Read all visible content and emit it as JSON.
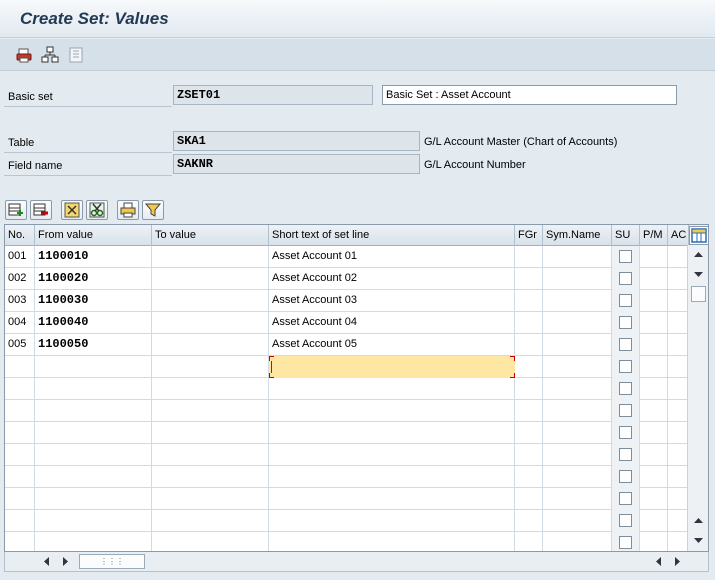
{
  "window": {
    "title": "Create Set: Values"
  },
  "app_toolbar": {
    "icons": [
      "print-icon",
      "hierarchy-icon",
      "document-icon"
    ]
  },
  "header": {
    "basic_set": {
      "label": "Basic set",
      "value": "ZSET01",
      "description": "Basic Set : Asset Account"
    },
    "table": {
      "label": "Table",
      "value": "SKA1",
      "description": "G/L Account Master (Chart of Accounts)"
    },
    "field_name": {
      "label": "Field name",
      "value": "SAKNR",
      "description": "G/L Account Number"
    }
  },
  "table_toolbar": {
    "buttons": [
      "insert-row",
      "delete-row",
      "select-block",
      "cut",
      "print",
      "filter"
    ]
  },
  "grid": {
    "columns": [
      "No.",
      "From value",
      "To value",
      "Short text of set line",
      "FGr",
      "Sym.Name",
      "SU",
      "P/M",
      "AC"
    ],
    "rows": [
      {
        "no": "001",
        "from": "1100010",
        "to": "",
        "text": "Asset Account 01"
      },
      {
        "no": "002",
        "from": "1100020",
        "to": "",
        "text": "Asset Account 02"
      },
      {
        "no": "003",
        "from": "1100030",
        "to": "",
        "text": "Asset Account 03"
      },
      {
        "no": "004",
        "from": "1100040",
        "to": "",
        "text": "Asset Account 04"
      },
      {
        "no": "005",
        "from": "1100050",
        "to": "",
        "text": "Asset Account 05"
      }
    ],
    "empty_rows": 9
  },
  "colors": {
    "active_cell": "#fde7a3",
    "title": "#223a54",
    "background": "#e3ebf1"
  }
}
